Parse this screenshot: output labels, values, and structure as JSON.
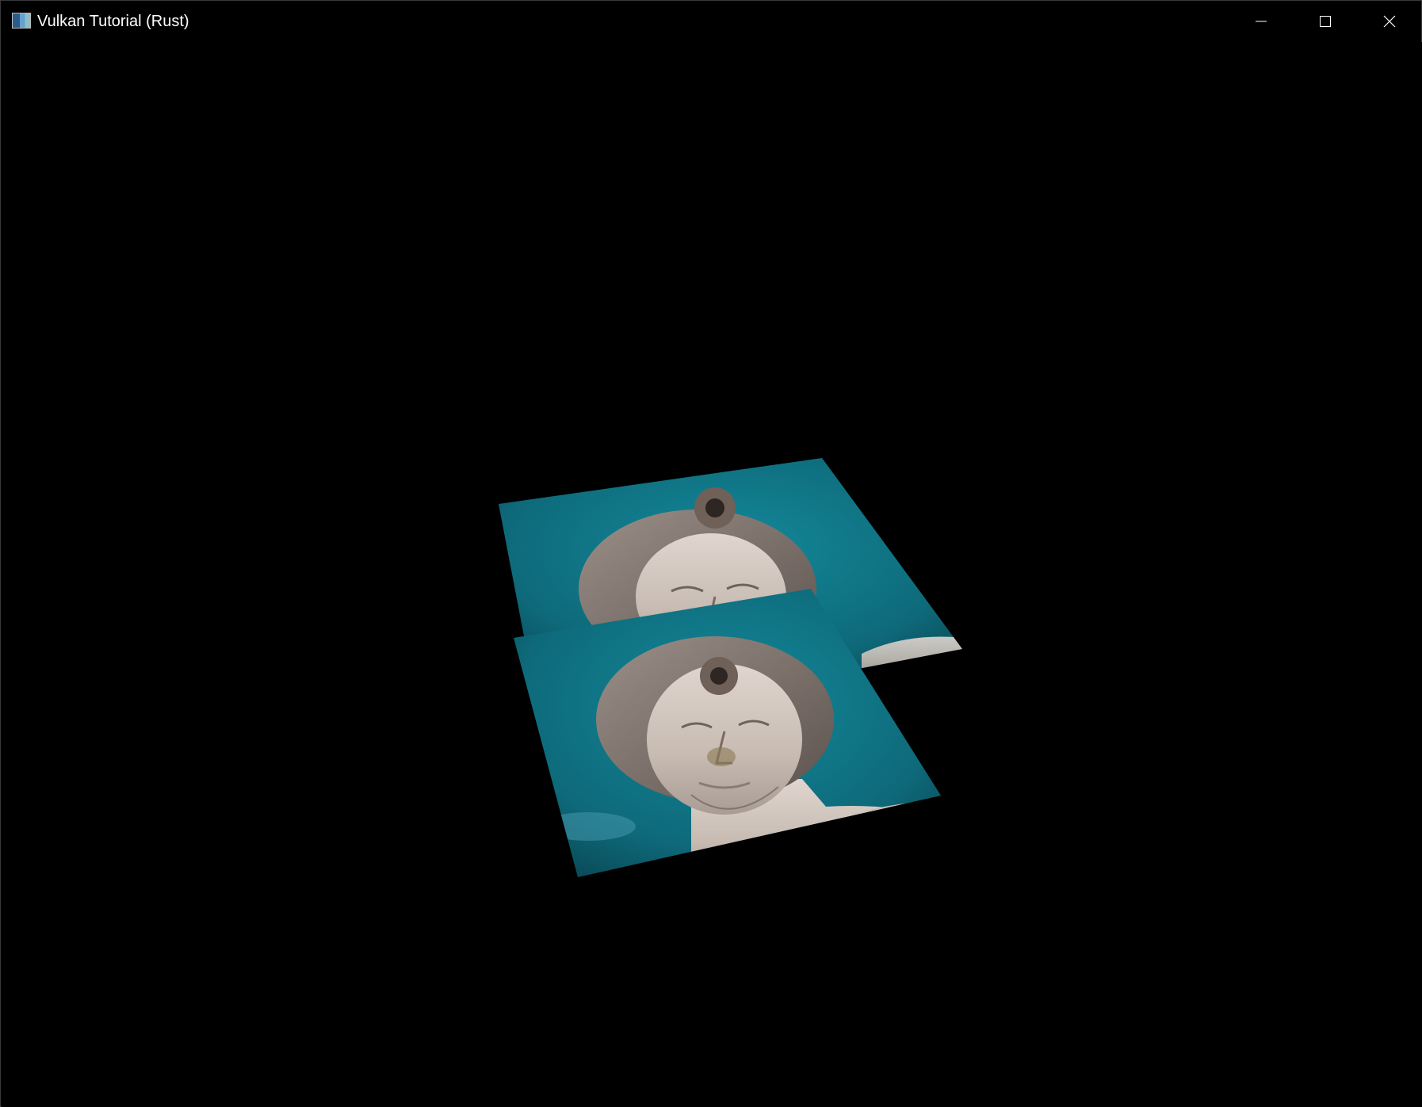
{
  "window": {
    "title": "Vulkan Tutorial (Rust)",
    "controls": {
      "minimize": "minimize-icon",
      "maximize": "maximize-icon",
      "close": "close-icon"
    }
  },
  "scene": {
    "background": "#000000",
    "quads": [
      {
        "name": "back-textured-quad",
        "texture": "statue-head-on-teal-sky"
      },
      {
        "name": "front-textured-quad",
        "texture": "statue-head-on-teal-sky"
      }
    ],
    "colors": {
      "sky": "#0f6f80",
      "sky_dark": "#0a4a5a",
      "stone": "#cfc3ba"
    }
  }
}
